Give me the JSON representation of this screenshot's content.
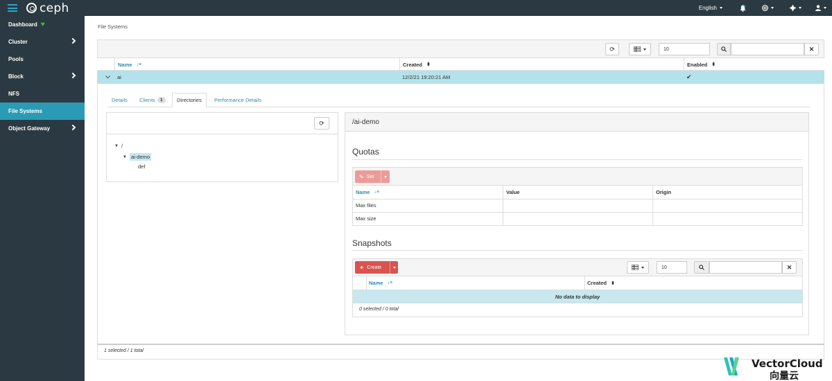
{
  "app": {
    "logo_text": "ceph"
  },
  "topbar": {
    "language": "English",
    "icons": [
      "bell-icon",
      "help-icon",
      "gear-icon",
      "user-icon"
    ]
  },
  "sidebar": {
    "items": [
      {
        "label": "Dashboard",
        "has_children": false,
        "status": "heart"
      },
      {
        "label": "Cluster",
        "has_children": true
      },
      {
        "label": "Pools",
        "has_children": false
      },
      {
        "label": "Block",
        "has_children": true
      },
      {
        "label": "NFS",
        "has_children": false
      },
      {
        "label": "File Systems",
        "has_children": false,
        "active": true
      },
      {
        "label": "Object Gateway",
        "has_children": true
      }
    ]
  },
  "breadcrumb": "File Systems",
  "fs_table": {
    "page_size": "10",
    "search_value": "",
    "columns": [
      "Name",
      "Created",
      "Enabled"
    ],
    "rows": [
      {
        "name": "ai",
        "created": "12/2/21 19:20:21 AM",
        "enabled": "✔"
      }
    ],
    "footer": "1 selected / 1 total"
  },
  "tabs": [
    {
      "label": "Details"
    },
    {
      "label": "Clients",
      "badge": "1"
    },
    {
      "label": "Directories",
      "active": true
    },
    {
      "label": "Performance Details"
    }
  ],
  "directories": {
    "tree": {
      "root": "/",
      "child": "ai-demo",
      "grandchild": "def"
    }
  },
  "detail": {
    "path": "/ai-demo",
    "quotas_title": "Quotas",
    "set_label": "Set",
    "quota_columns": [
      "Name",
      "Value",
      "Origin"
    ],
    "quota_rows": [
      {
        "name": "Max files",
        "value": "",
        "origin": ""
      },
      {
        "name": "Max size",
        "value": "",
        "origin": ""
      }
    ],
    "snapshots_title": "Snapshots",
    "create_label": "Create",
    "snap_page_size": "10",
    "snap_columns": [
      "Name",
      "Created"
    ],
    "snap_empty": "No data to display",
    "snap_footer": "0 selected / 0 total"
  },
  "watermark": {
    "brand": "VectorCloud",
    "sub": "向量云"
  },
  "colors": {
    "accent": "#2b9bb5",
    "sidebar_bg": "#2b3a42",
    "selected_row": "#b4e2ea",
    "danger": "#d9534f"
  }
}
